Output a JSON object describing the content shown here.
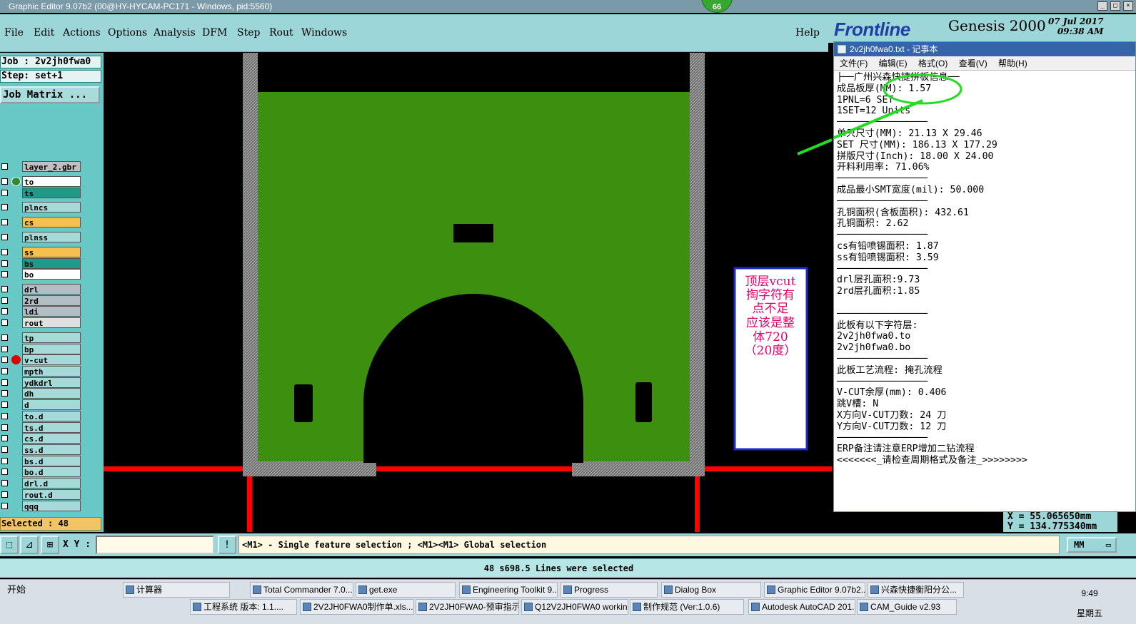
{
  "window": {
    "title": "Graphic Editor 9.07b2 (00@HY-HYCAM-PC171 - Windows, pid:5560)",
    "badge": "66"
  },
  "menu": [
    "File",
    "Edit",
    "Actions",
    "Options",
    "Analysis",
    "DFM",
    "Step",
    "Rout",
    "Windows"
  ],
  "help_label": "Help",
  "brand": {
    "logo": "Frontline",
    "product": "Genesis 2000",
    "date": "07 Jul 2017",
    "time": "09:38 AM"
  },
  "left_panel": {
    "job": "Job : 2v2jh0fwa0",
    "step": "Step: set+1",
    "job_matrix": "Job Matrix ...",
    "selected": "Selected : 48"
  },
  "layers": [
    {
      "name": "layer_2.gbr",
      "color": "#c0c0c0",
      "group": 0,
      "status": "none"
    },
    {
      "name": "to",
      "color": "#ffffff",
      "group": 1,
      "status": "active"
    },
    {
      "name": "ts",
      "color": "#1f9a86",
      "group": 1,
      "status": "none"
    },
    {
      "name": "plncs",
      "color": "#a6dad8",
      "group": 2,
      "status": "none"
    },
    {
      "name": "cs",
      "color": "#f6c04f",
      "group": 3,
      "status": "none"
    },
    {
      "name": "plnss",
      "color": "#a6dad8",
      "group": 4,
      "status": "none"
    },
    {
      "name": "ss",
      "color": "#f6c04f",
      "group": 5,
      "status": "none"
    },
    {
      "name": "bs",
      "color": "#1f9a86",
      "group": 5,
      "status": "none"
    },
    {
      "name": "bo",
      "color": "#ffffff",
      "group": 5,
      "status": "none"
    },
    {
      "name": "drl",
      "color": "#b4bcc4",
      "group": 6,
      "status": "none"
    },
    {
      "name": "2rd",
      "color": "#b4bcc4",
      "group": 6,
      "status": "none"
    },
    {
      "name": "ldi",
      "color": "#b4bcc4",
      "group": 6,
      "status": "none"
    },
    {
      "name": "rout",
      "color": "#e0e0e0",
      "group": 6,
      "status": "none"
    },
    {
      "name": "tp",
      "color": "#a6dad8",
      "group": 7,
      "status": "none"
    },
    {
      "name": "bp",
      "color": "#a6dad8",
      "group": 7,
      "status": "none"
    },
    {
      "name": "v-cut",
      "color": "#a6dad8",
      "group": 7,
      "status": "affected"
    },
    {
      "name": "mpth",
      "color": "#a6dad8",
      "group": 7,
      "status": "none"
    },
    {
      "name": "ydkdrl",
      "color": "#a6dad8",
      "group": 7,
      "status": "none"
    },
    {
      "name": "dh",
      "color": "#a6dad8",
      "group": 7,
      "status": "none"
    },
    {
      "name": "d",
      "color": "#a6dad8",
      "group": 7,
      "status": "none"
    },
    {
      "name": "to.d",
      "color": "#a6dad8",
      "group": 7,
      "status": "none"
    },
    {
      "name": "ts.d",
      "color": "#a6dad8",
      "group": 7,
      "status": "none"
    },
    {
      "name": "cs.d",
      "color": "#a6dad8",
      "group": 7,
      "status": "none"
    },
    {
      "name": "ss.d",
      "color": "#a6dad8",
      "group": 7,
      "status": "none"
    },
    {
      "name": "bs.d",
      "color": "#a6dad8",
      "group": 7,
      "status": "none"
    },
    {
      "name": "bo.d",
      "color": "#a6dad8",
      "group": 7,
      "status": "none"
    },
    {
      "name": "drl.d",
      "color": "#a6dad8",
      "group": 7,
      "status": "none"
    },
    {
      "name": "rout.d",
      "color": "#a6dad8",
      "group": 7,
      "status": "none"
    },
    {
      "name": "qqq",
      "color": "#a6dad8",
      "group": 7,
      "status": "none"
    }
  ],
  "canvas": {
    "board_color": "#3d8f0f",
    "frame_color": "#8a8a8a",
    "vcut_color": "#ff0000",
    "annotation": [
      "顶层vcut",
      "掏字符有",
      "点不足",
      "应该是整",
      "体720",
      "（20度）"
    ],
    "annotation_color": "#e4006b",
    "pointer_color": "#22dd22"
  },
  "notepad": {
    "title": "2v2jh0fwa0.txt - 记事本",
    "menu": [
      "文件(F)",
      "编辑(E)",
      "格式(O)",
      "查看(V)",
      "帮助(H)"
    ],
    "lines": [
      "├──广州兴森快捷拼板信息──",
      "成品板厚(MM): 1.57",
      "1PNL=6 SET",
      "1SET=12 Units",
      "────────────────",
      "单只尺寸(MM): 21.13 X 29.46",
      "SET 尺寸(MM): 186.13 X 177.29",
      "拼版尺寸(Inch): 18.00 X 24.00",
      "开料利用率: 71.06%",
      "────────────────",
      "成品最小SMT宽度(mil): 50.000",
      "────────────────",
      "孔铜面积(含板面积): 432.61",
      "孔铜面积: 2.62",
      "────────────────",
      "cs有铅喷锡面积: 1.87",
      "ss有铅喷锡面积: 3.59",
      "────────────────",
      "drl层孔面积:9.73",
      "2rd层孔面积:1.85",
      "",
      "────────────────",
      "此板有以下字符层:",
      "2v2jh0fwa0.to",
      "2v2jh0fwa0.bo",
      "────────────────",
      "此板工艺流程: 掩孔流程",
      "────────────────",
      "V-CUT余厚(mm): 0.406",
      "跳V槽: N",
      "X方向V-CUT刀数: 24 刀",
      "Y方向V-CUT刀数: 12 刀",
      "────────────────",
      "ERP备注请注意ERP增加二钻流程",
      "<<<<<<<_请检查周期格式及备注_>>>>>>>>"
    ]
  },
  "coords": {
    "x": "X = 55.065650mm",
    "y": "Y = 134.775340mm"
  },
  "command": {
    "xy_label": "X Y :",
    "xy_value": "",
    "hint": "<M1> - Single feature selection ; <M1><M1> Global selection",
    "unit": "MM"
  },
  "status_message": "48 s698.5 Lines were selected",
  "taskbar": {
    "start": "开始",
    "row1": [
      "计算器",
      "Total Commander 7.0...",
      "get.exe",
      "Engineering Toolkit 9....",
      "Progress",
      "Dialog Box",
      "Graphic Editor 9.07b2...",
      "兴森快捷衡阳分公..."
    ],
    "row2": [
      "工程系统  版本: 1.1....",
      "2V2JH0FWA0制作单.xls...",
      "2V2JH0FWA0-预审指示...",
      "Q12V2JH0FWA0 workin...",
      "制作规范 (Ver:1.0.6)",
      "Autodesk AutoCAD 201...",
      "CAM_Guide v2.93"
    ],
    "time": "9:49",
    "day": "星期五"
  }
}
